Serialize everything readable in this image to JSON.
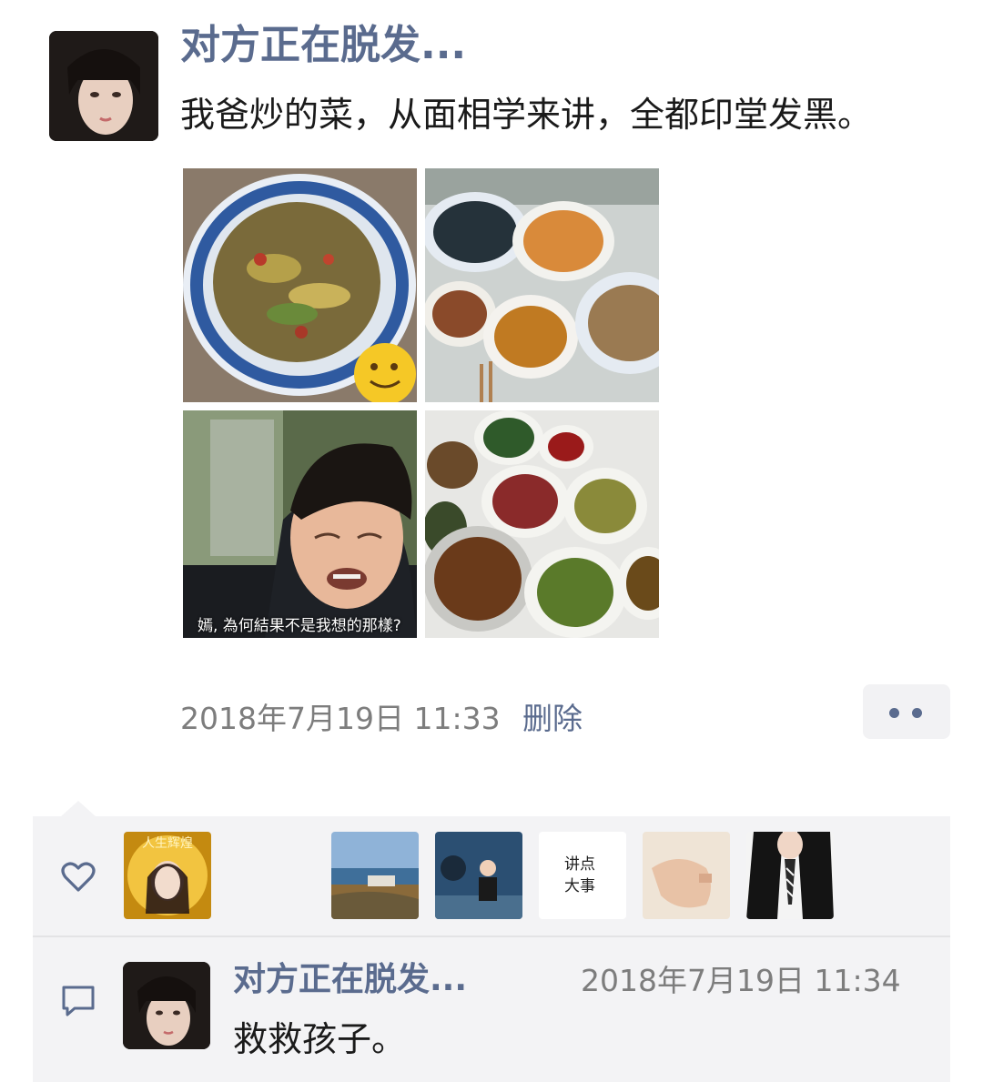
{
  "post": {
    "username": "对方正在脱发...",
    "text": "我爸炒的菜，从面相学来讲，全都印堂发黑。",
    "timestamp": "2018年7月19日 11:33",
    "delete_label": "删除",
    "photos": [
      {
        "kind": "stir-fry-bowl-with-smiley"
      },
      {
        "kind": "dishes-on-table"
      },
      {
        "kind": "crying-man-screenshot",
        "caption": "嫣, 為何結果不是我想的那樣?"
      },
      {
        "kind": "many-dishes-on-table"
      }
    ]
  },
  "likes": {
    "icon": "heart-icon",
    "avatars": [
      {
        "kind": "golden-portrait",
        "text": "人生辉煌"
      },
      {
        "kind": "blank"
      },
      {
        "kind": "coastal-landscape"
      },
      {
        "kind": "child-photo"
      },
      {
        "kind": "text-avatar",
        "text": "讲点大事"
      },
      {
        "kind": "hand-photo"
      },
      {
        "kind": "girl-with-tie"
      }
    ]
  },
  "comment": {
    "icon": "comment-icon",
    "username": "对方正在脱发...",
    "timestamp": "2018年7月19日 11:34",
    "text": "救救孩子。"
  },
  "colors": {
    "link": "#5a6b8e",
    "meta": "#7d7d7d",
    "panel": "#f3f3f5"
  }
}
